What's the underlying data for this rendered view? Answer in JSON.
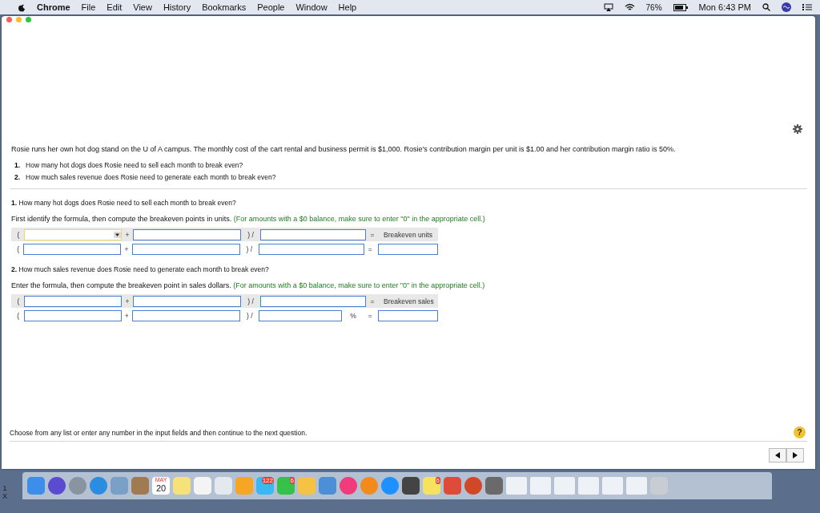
{
  "menu_bar": {
    "app": "Chrome",
    "items": [
      "File",
      "Edit",
      "View",
      "History",
      "Bookmarks",
      "People",
      "Window",
      "Help"
    ],
    "battery": "76%",
    "clock": "Mon 6:43 PM"
  },
  "problem": {
    "intro": "Rosie runs her own hot dog stand on the U of A campus. The monthly cost of the cart rental and business permit is $1,000. Rosie's contribution margin per unit is $1.00 and her contribution margin ratio is 50%.",
    "questions": [
      {
        "number": "1.",
        "text": "How many hot dogs does Rosie need to sell each month to break even?"
      },
      {
        "number": "2.",
        "text": "How much sales revenue does Rosie need to generate each month to break even?"
      }
    ]
  },
  "parts": [
    {
      "number": "1.",
      "title": "How many hot dogs does Rosie need to sell each month to break even?",
      "instruction": "First identify the formula, then compute the breakeven points in units.",
      "note": "(For amounts with a $0 balance, make sure to enter \"0\" in the appropriate cell.)",
      "rows": [
        {
          "shaded": true,
          "cells": [
            {
              "kind": "text",
              "text": "("
            },
            {
              "kind": "dropdown",
              "highlighted": true
            },
            {
              "kind": "text",
              "text": "+"
            },
            {
              "kind": "field"
            },
            {
              "kind": "text",
              "text": ") /"
            },
            {
              "kind": "field"
            },
            {
              "kind": "text",
              "text": "="
            },
            {
              "kind": "label",
              "text": "Breakeven units"
            }
          ]
        },
        {
          "shaded": false,
          "cells": [
            {
              "kind": "text",
              "text": "("
            },
            {
              "kind": "field"
            },
            {
              "kind": "text",
              "text": "+"
            },
            {
              "kind": "field"
            },
            {
              "kind": "text",
              "text": ") /"
            },
            {
              "kind": "field"
            },
            {
              "kind": "text",
              "text": "="
            },
            {
              "kind": "result"
            }
          ]
        }
      ]
    },
    {
      "number": "2.",
      "title": "How much sales revenue does Rosie need to generate each month to break even?",
      "instruction": "Enter the formula, then compute the breakeven point in sales dollars.",
      "note": "(For amounts with a $0 balance, make sure to enter \"0\" in the appropriate cell.)",
      "rows": [
        {
          "shaded": true,
          "cells": [
            {
              "kind": "text",
              "text": "("
            },
            {
              "kind": "field"
            },
            {
              "kind": "text",
              "text": "+"
            },
            {
              "kind": "field"
            },
            {
              "kind": "text",
              "text": ") /"
            },
            {
              "kind": "field"
            },
            {
              "kind": "text",
              "text": "="
            },
            {
              "kind": "label",
              "text": "Breakeven sales"
            }
          ]
        },
        {
          "shaded": false,
          "cells": [
            {
              "kind": "text",
              "text": "("
            },
            {
              "kind": "field"
            },
            {
              "kind": "text",
              "text": "+"
            },
            {
              "kind": "field"
            },
            {
              "kind": "text",
              "text": ") /"
            },
            {
              "kind": "field",
              "suffix": "%"
            },
            {
              "kind": "text",
              "text": "="
            },
            {
              "kind": "result"
            }
          ]
        }
      ]
    }
  ],
  "footer": {
    "hint": "Choose from any list or enter any number in the input fields and then continue to the next question.",
    "help": "?"
  },
  "background_sheet": {
    "labels": [
      "1",
      "X"
    ]
  },
  "dock": {
    "calendar_month": "MAY",
    "calendar_day": "20",
    "badges": [
      "122",
      "6",
      "6"
    ]
  }
}
